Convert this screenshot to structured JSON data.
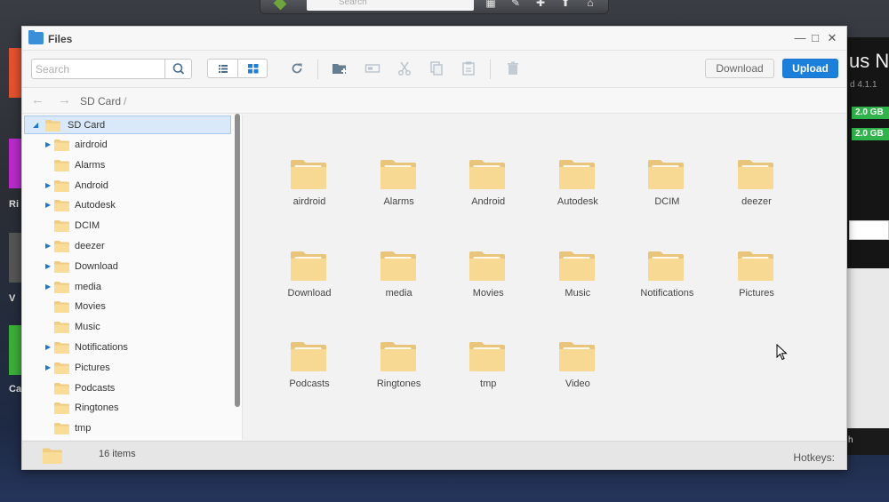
{
  "desktop": {
    "top_search_placeholder": "Search",
    "right_panel": {
      "title_fragment": "us N",
      "version_fragment": "d 4.1.1",
      "storage_bars": [
        "2.0 GB",
        "2.0 GB"
      ],
      "bottom_fragment": "h"
    },
    "left_labels": [
      "Ri",
      "V",
      "Ca"
    ]
  },
  "window": {
    "title": "Files",
    "controls": {
      "minimize": "—",
      "maximize": "□",
      "close": "✕"
    }
  },
  "toolbar": {
    "search_placeholder": "Search",
    "download_label": "Download",
    "upload_label": "Upload",
    "accent_color": "#1b7fdc"
  },
  "pathbar": {
    "crumb": "SD Card",
    "separator": "/"
  },
  "tree": {
    "root": "SD Card",
    "items": [
      {
        "label": "airdroid",
        "expandable": true
      },
      {
        "label": "Alarms",
        "expandable": false
      },
      {
        "label": "Android",
        "expandable": true
      },
      {
        "label": "Autodesk",
        "expandable": true
      },
      {
        "label": "DCIM",
        "expandable": false
      },
      {
        "label": "deezer",
        "expandable": true
      },
      {
        "label": "Download",
        "expandable": true
      },
      {
        "label": "media",
        "expandable": true
      },
      {
        "label": "Movies",
        "expandable": false
      },
      {
        "label": "Music",
        "expandable": false
      },
      {
        "label": "Notifications",
        "expandable": true
      },
      {
        "label": "Pictures",
        "expandable": true
      },
      {
        "label": "Podcasts",
        "expandable": false
      },
      {
        "label": "Ringtones",
        "expandable": false
      },
      {
        "label": "tmp",
        "expandable": false
      }
    ]
  },
  "files": [
    "airdroid",
    "Alarms",
    "Android",
    "Autodesk",
    "DCIM",
    "deezer",
    "Download",
    "media",
    "Movies",
    "Music",
    "Notifications",
    "Pictures",
    "Podcasts",
    "Ringtones",
    "tmp",
    "Video"
  ],
  "status": {
    "count": "16 items",
    "hotkeys": "Hotkeys:"
  }
}
